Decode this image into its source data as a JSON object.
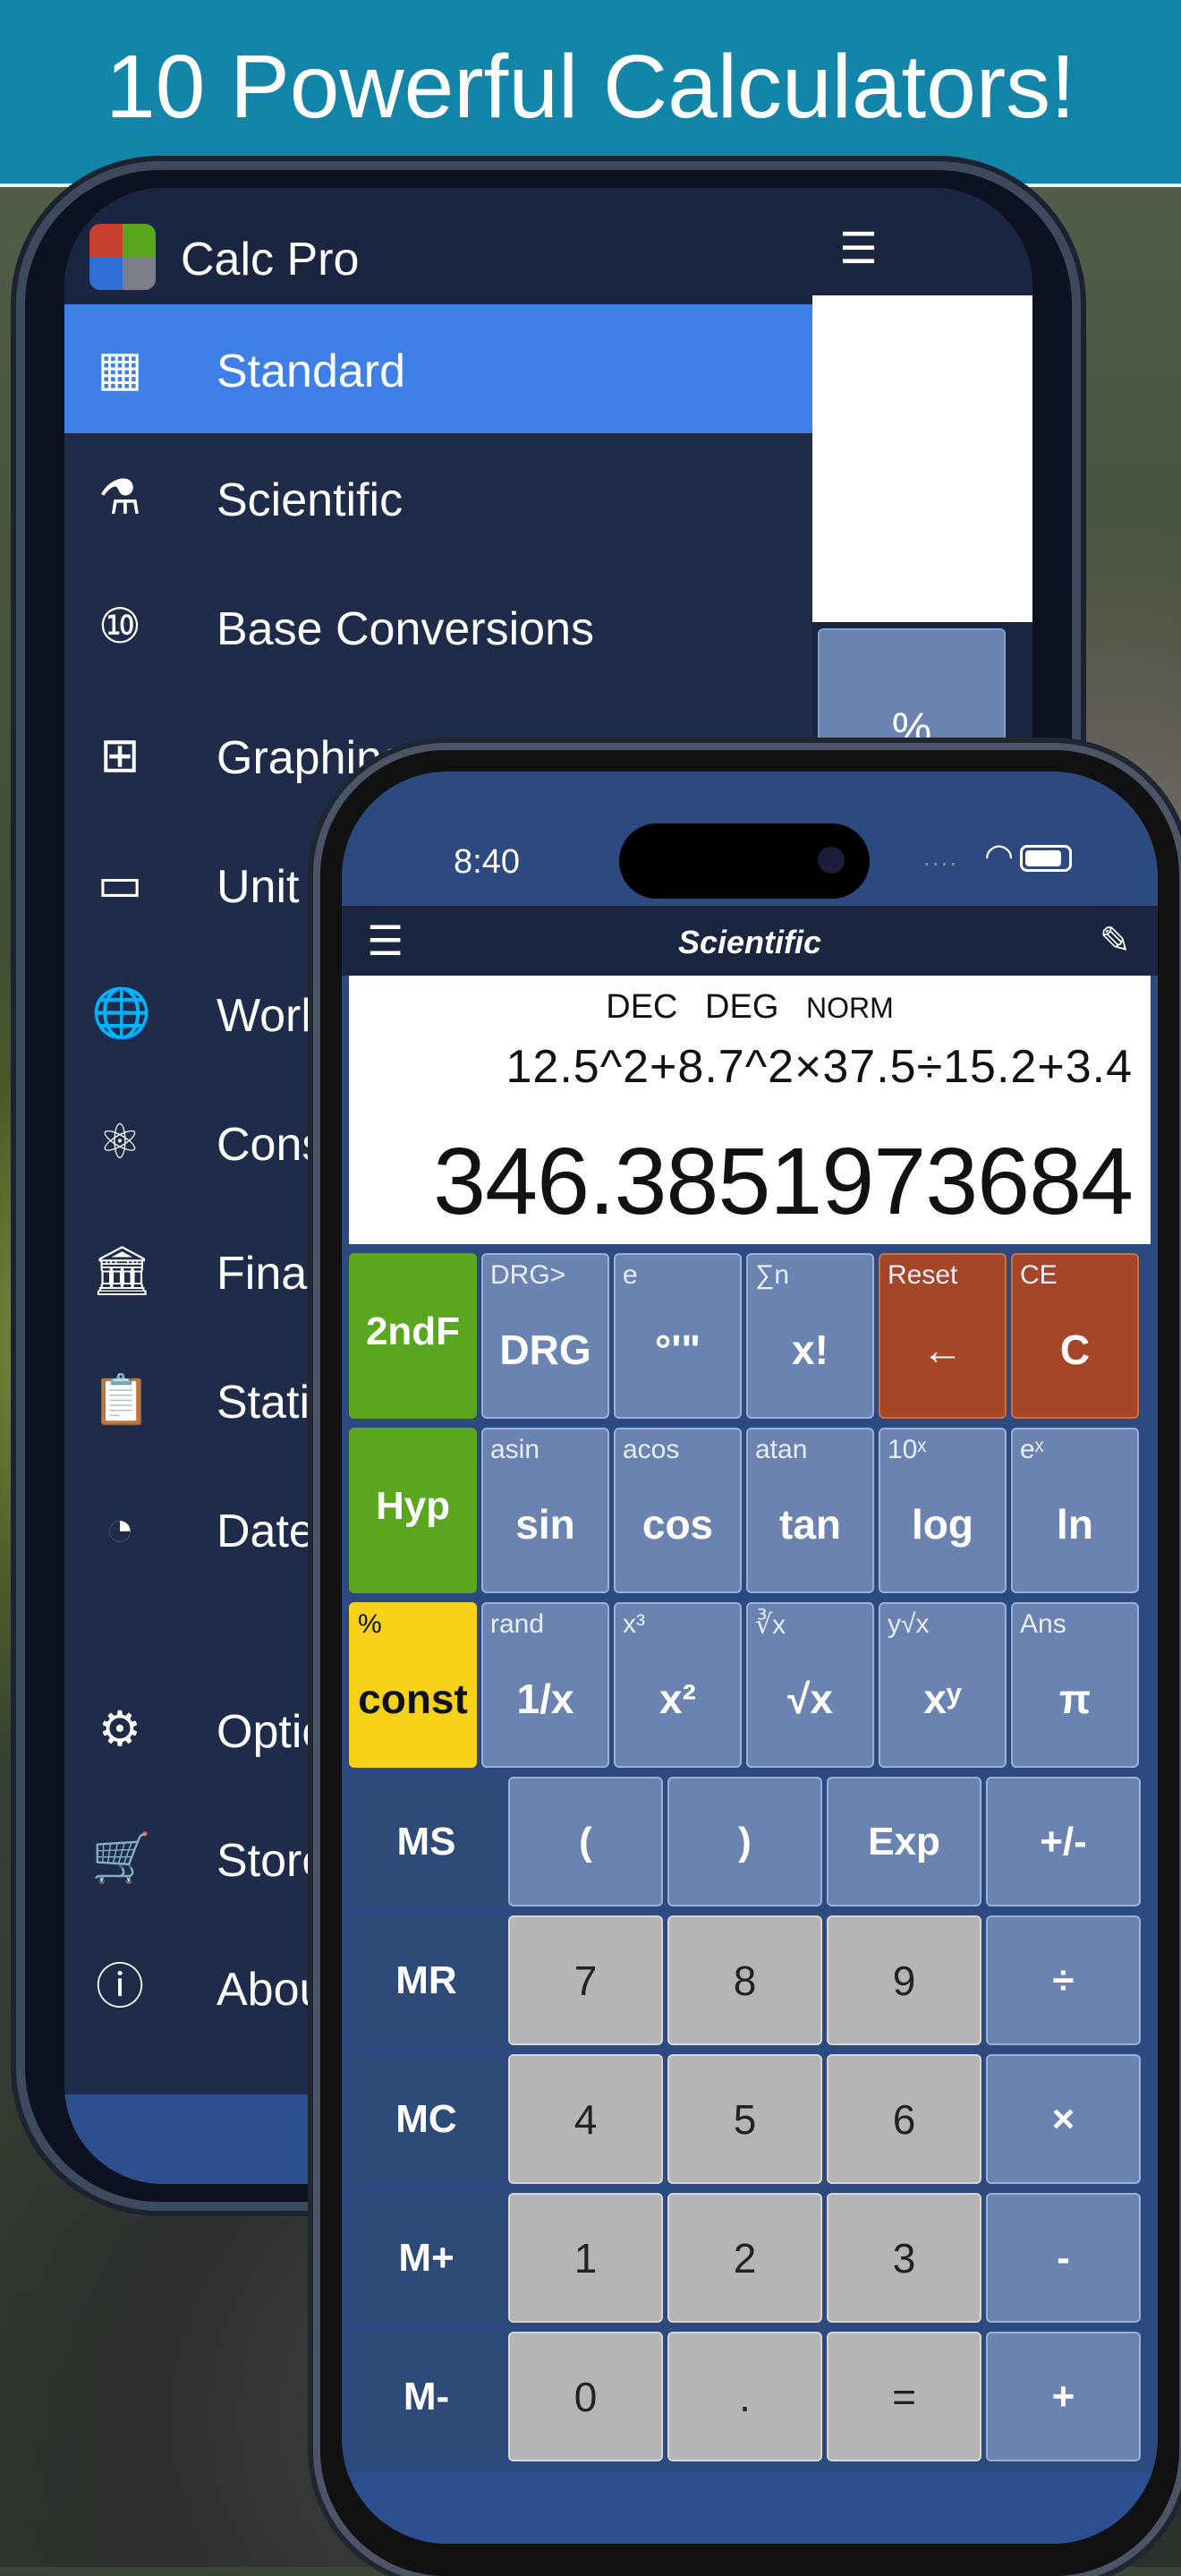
{
  "banner": {
    "title": "10 Powerful Calculators!"
  },
  "back_phone": {
    "app_name": "Calc Pro",
    "menu": [
      {
        "label": "Standard",
        "icon": "calculator-icon",
        "glyph": "▦",
        "active": true
      },
      {
        "label": "Scientific",
        "icon": "microscope-icon",
        "glyph": "⚗"
      },
      {
        "label": "Base Conversions",
        "icon": "binary-icon",
        "glyph": "⑩"
      },
      {
        "label": "Graphing",
        "icon": "graph-icon",
        "glyph": "⊞"
      },
      {
        "label": "Unit",
        "icon": "ruler-icon",
        "glyph": "▭"
      },
      {
        "label": "Worl",
        "icon": "globe-icon",
        "glyph": "🌐"
      },
      {
        "label": "Cons",
        "icon": "atom-icon",
        "glyph": "⚛"
      },
      {
        "label": "Fina",
        "icon": "bank-icon",
        "glyph": "🏛"
      },
      {
        "label": "Stati",
        "icon": "clipboard-chart-icon",
        "glyph": "📋"
      },
      {
        "label": "Date",
        "icon": "clock-calendar-icon",
        "glyph": "◔"
      }
    ],
    "menu_bottom": [
      {
        "label": "Optio",
        "icon": "gear-icon",
        "glyph": "⚙"
      },
      {
        "label": "Store",
        "icon": "cart-icon",
        "glyph": "🛒"
      },
      {
        "label": "Abou",
        "icon": "info-icon",
        "glyph": "ⓘ"
      }
    ],
    "right_pane": {
      "menu_glyph": "☰",
      "visible_key": "%"
    }
  },
  "front_phone": {
    "status": {
      "time": "8:40",
      "dots": "....",
      "wifi_glyph": "◠"
    },
    "navbar": {
      "menu_glyph": "☰",
      "title": "Scientific",
      "brush_glyph": "✎"
    },
    "display": {
      "modes": [
        "DEC",
        "DEG",
        "NORM"
      ],
      "expression": "12.5^2+8.7^2×37.5÷15.2+3.4",
      "result": "346.3851973684"
    },
    "keys_sci": [
      [
        {
          "sec": "",
          "main": "2ndF",
          "type": "green"
        },
        {
          "sec": "DRG>",
          "main": "DRG"
        },
        {
          "sec": "e",
          "main": "°'\""
        },
        {
          "sec": "∑n",
          "main": "x!"
        },
        {
          "sec": "Reset",
          "main": "←",
          "type": "red"
        },
        {
          "sec": "CE",
          "main": "C",
          "type": "red"
        }
      ],
      [
        {
          "sec": "",
          "main": "Hyp",
          "type": "green"
        },
        {
          "sec": "asin",
          "main": "sin"
        },
        {
          "sec": "acos",
          "main": "cos"
        },
        {
          "sec": "atan",
          "main": "tan"
        },
        {
          "sec": "10ˣ",
          "main": "log"
        },
        {
          "sec": "eˣ",
          "main": "ln"
        }
      ],
      [
        {
          "sec": "%",
          "main": "const",
          "type": "yellow"
        },
        {
          "sec": "rand",
          "main": "1/x"
        },
        {
          "sec": "x³",
          "main": "x²"
        },
        {
          "sec": "∛x",
          "main": "√x"
        },
        {
          "sec": "y√x",
          "main": "xʸ"
        },
        {
          "sec": "Ans",
          "main": "π"
        }
      ]
    ],
    "keys_basic": [
      [
        {
          "l": "MS",
          "t": "dark"
        },
        {
          "l": "("
        },
        {
          "l": ")"
        },
        {
          "l": "Exp"
        },
        {
          "l": "+/-"
        }
      ],
      [
        {
          "l": "MR",
          "t": "dark"
        },
        {
          "l": "7",
          "t": "gray"
        },
        {
          "l": "8",
          "t": "gray"
        },
        {
          "l": "9",
          "t": "gray"
        },
        {
          "l": "÷"
        }
      ],
      [
        {
          "l": "MC",
          "t": "dark"
        },
        {
          "l": "4",
          "t": "gray"
        },
        {
          "l": "5",
          "t": "gray"
        },
        {
          "l": "6",
          "t": "gray"
        },
        {
          "l": "×"
        }
      ],
      [
        {
          "l": "M+",
          "t": "dark"
        },
        {
          "l": "1",
          "t": "gray"
        },
        {
          "l": "2",
          "t": "gray"
        },
        {
          "l": "3",
          "t": "gray"
        },
        {
          "l": "-"
        }
      ],
      [
        {
          "l": "M-",
          "t": "dark"
        },
        {
          "l": "0",
          "t": "gray"
        },
        {
          "l": ".",
          "t": "gray"
        },
        {
          "l": "=",
          "t": "gray"
        },
        {
          "l": "+"
        }
      ]
    ]
  }
}
